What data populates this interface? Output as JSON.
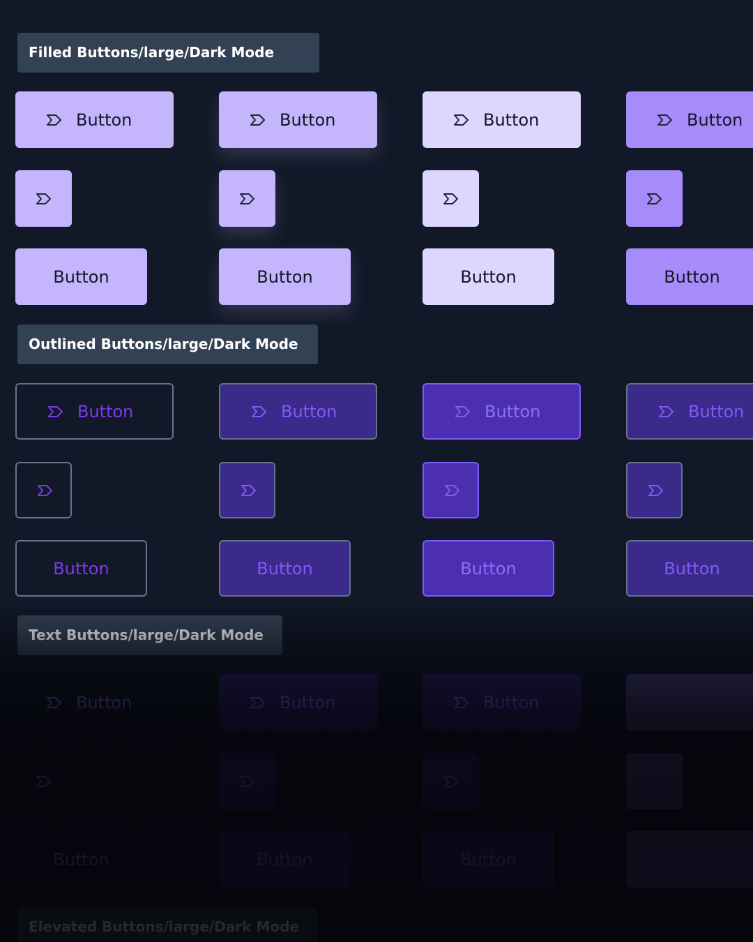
{
  "sections": [
    {
      "label": "Filled Buttons/large/Dark Mode"
    },
    {
      "label": "Outlined Buttons/large/Dark Mode"
    },
    {
      "label": "Text Buttons/large/Dark Mode"
    },
    {
      "label": "Elevated Buttons/large/Dark Mode"
    }
  ],
  "button_label": "Button",
  "icon": "tag-icon",
  "colors": {
    "background": "#111827",
    "section_label_bg": "#334155",
    "filled": [
      "#c4b5fd",
      "#c4b5fd",
      "#ddd6fe",
      "#a78bfa"
    ],
    "outlined_text": "#7c3aed",
    "outlined_bg": [
      "#111827",
      "#3b2a8a",
      "#4c2fb0",
      "#3b2a8a"
    ],
    "text_button_bg": [
      "transparent",
      "#2e1f6b",
      "#2e1f6b",
      "#43407a"
    ]
  }
}
